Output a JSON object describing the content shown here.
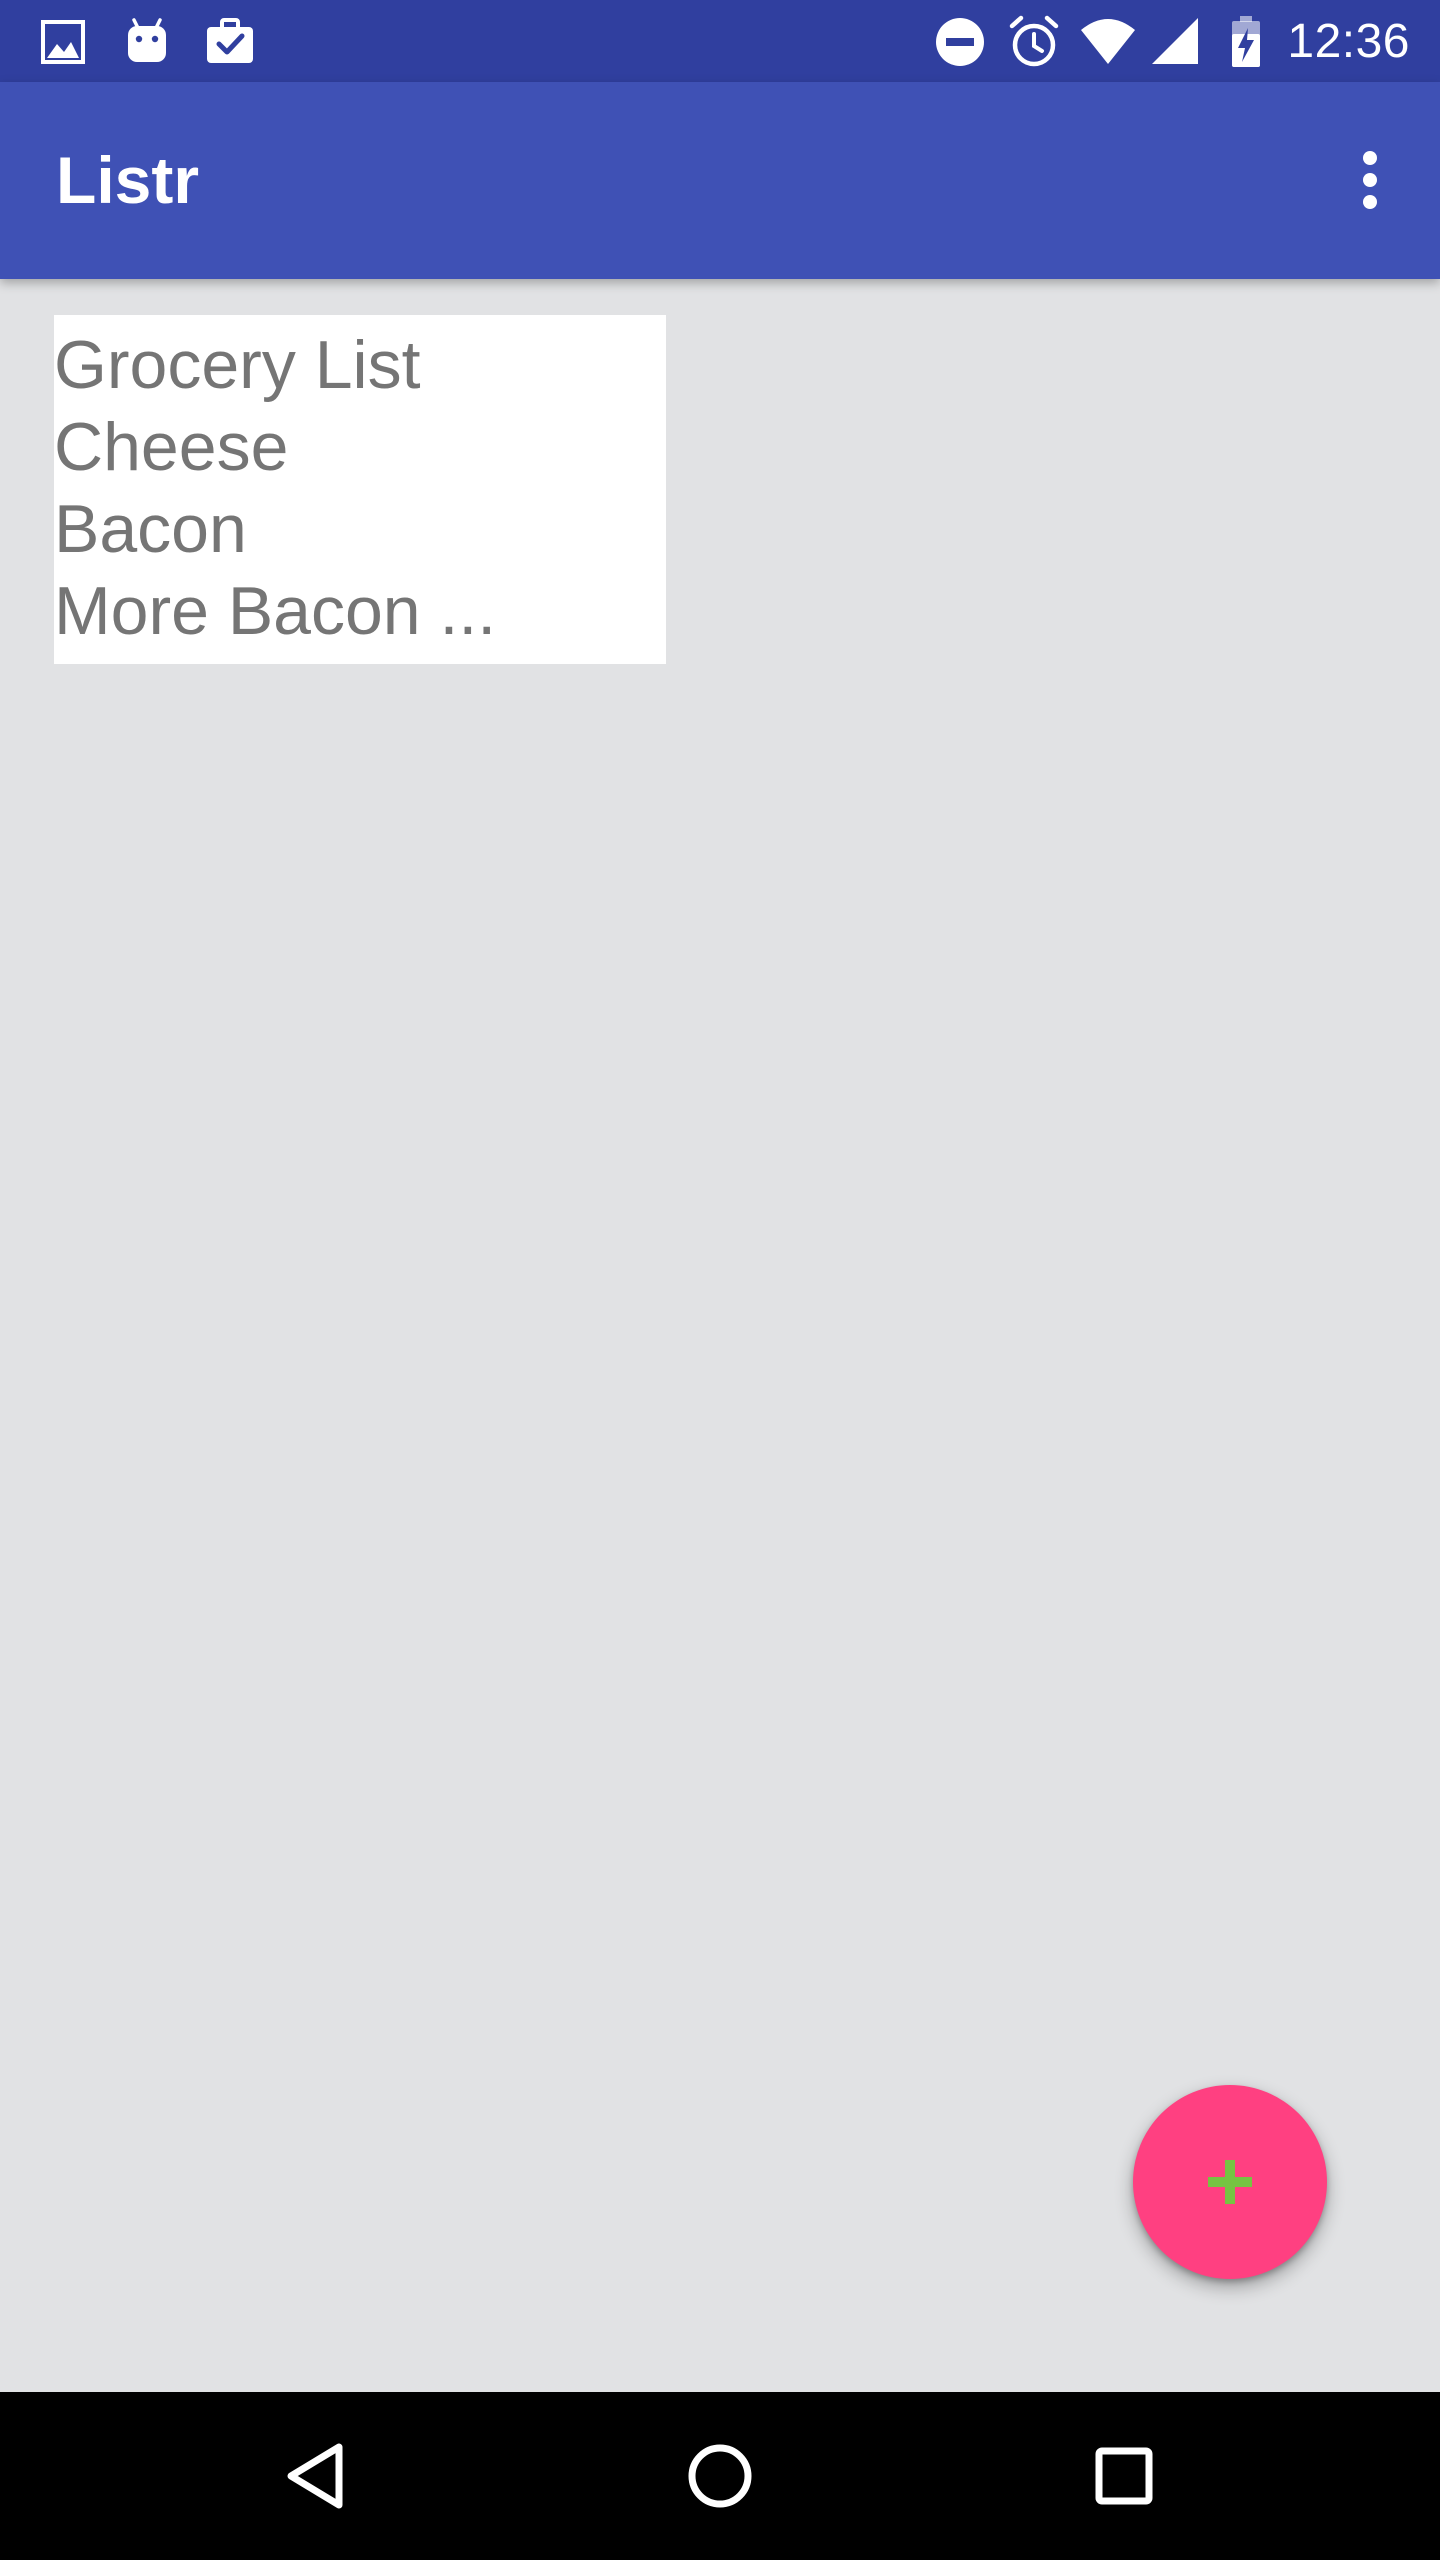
{
  "status_bar": {
    "time": "12:36",
    "left_icons": [
      "image-icon",
      "android-icon",
      "task-briefcase-icon"
    ],
    "right_icons": [
      "do-not-disturb-icon",
      "alarm-icon",
      "wifi-icon",
      "cell-signal-icon",
      "battery-charging-icon"
    ]
  },
  "app_bar": {
    "title": "Listr",
    "overflow_icon": "more-vert-icon"
  },
  "lists": [
    {
      "title": "Grocery List",
      "items": [
        "Cheese",
        "Bacon",
        "More Bacon ..."
      ]
    }
  ],
  "fab": {
    "icon": "add-icon"
  },
  "nav_bar": {
    "icons": [
      "back-icon",
      "home-icon",
      "recents-icon"
    ]
  },
  "colors": {
    "status_bar": "#303F9F",
    "app_bar": "#3F51B5",
    "background": "#E1E2E4",
    "card": "#FFFFFF",
    "card_text": "#757575",
    "fab": "#FF4081",
    "fab_icon": "#76C442",
    "nav_bar": "#000000"
  }
}
